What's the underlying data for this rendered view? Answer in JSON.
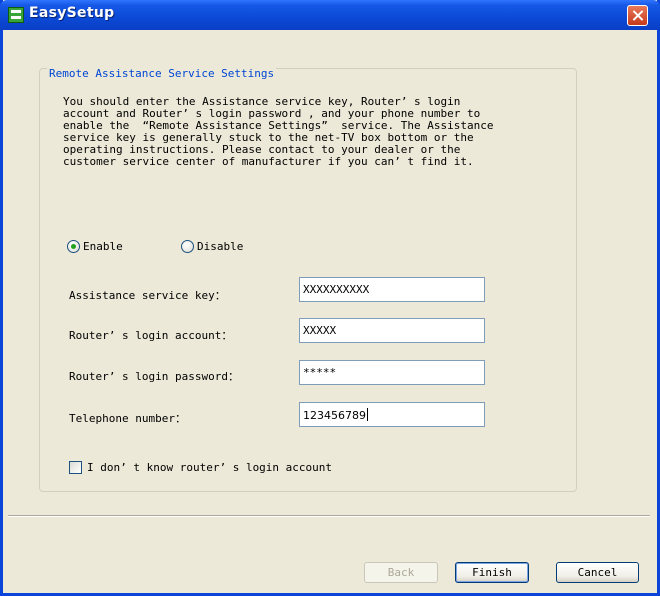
{
  "window": {
    "title": "EasySetup",
    "app_icon": "easysetup-icon",
    "close_icon": "close-icon"
  },
  "group": {
    "title": "Remote Assistance Service Settings",
    "description": "You should enter the Assistance service key, Router’ s login\naccount and Router’ s login password , and your phone number to\nenable the  “Remote Assistance Settings”  service. The Assistance\nservice key is generally stuck to the net-TV box bottom or the\noperating instructions. Please contact to your dealer or the\ncustomer service center of manufacturer if you can’ t find it."
  },
  "mode": {
    "enable_label": "Enable",
    "disable_label": "Disable",
    "selected": "Enable"
  },
  "fields": {
    "service_key": {
      "label": "Assistance service key：",
      "value": "XXXXXXXXXX"
    },
    "login_account": {
      "label": "Router’ s login account：",
      "value": "XXXXX"
    },
    "login_password": {
      "label": "Router’ s login password：",
      "value": "*****"
    },
    "telephone": {
      "label": "Telephone number：",
      "value": "123456789"
    }
  },
  "unknown_account_checkbox": {
    "label": "I don’ t know router’ s login account",
    "checked": false
  },
  "buttons": {
    "back": "Back",
    "finish": "Finish",
    "cancel": "Cancel"
  },
  "colors": {
    "titlebar": "#0a49d6",
    "group_title": "#0046d5",
    "radio_selected": "#21a121"
  }
}
